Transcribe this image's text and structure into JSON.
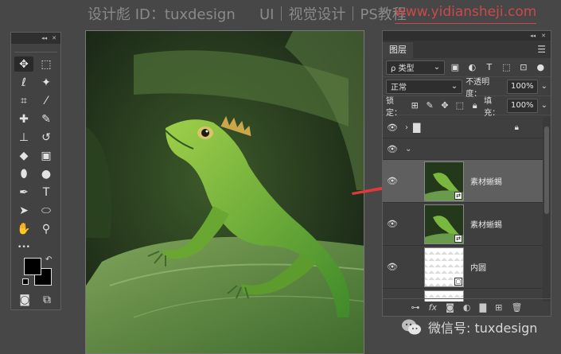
{
  "watermark": {
    "designer": "设计彪 ID：tuxdesign",
    "topic": "UI｜视觉设计｜PS教程",
    "site": "www.yidiansheji.com"
  },
  "tools_panel": {
    "header_icons": [
      "collapse-icon",
      "close-icon"
    ],
    "tools": [
      {
        "name": "move-tool-icon",
        "glyph": "✥",
        "active": true
      },
      {
        "name": "marquee-tool-icon",
        "glyph": "⬚"
      },
      {
        "name": "lasso-tool-icon",
        "glyph": "ℓ"
      },
      {
        "name": "magic-wand-tool-icon",
        "glyph": "✦"
      },
      {
        "name": "crop-tool-icon",
        "glyph": "⌗"
      },
      {
        "name": "eyedropper-tool-icon",
        "glyph": "⁄"
      },
      {
        "name": "healing-brush-tool-icon",
        "glyph": "✚"
      },
      {
        "name": "brush-tool-icon",
        "glyph": "✎"
      },
      {
        "name": "clone-stamp-tool-icon",
        "glyph": "⊥"
      },
      {
        "name": "history-brush-tool-icon",
        "glyph": "↺"
      },
      {
        "name": "eraser-tool-icon",
        "glyph": "◆"
      },
      {
        "name": "gradient-tool-icon",
        "glyph": "▣"
      },
      {
        "name": "blur-tool-icon",
        "glyph": "⬮"
      },
      {
        "name": "dodge-tool-icon",
        "glyph": "●"
      },
      {
        "name": "pen-tool-icon",
        "glyph": "✒"
      },
      {
        "name": "type-tool-icon",
        "glyph": "T"
      },
      {
        "name": "path-selection-tool-icon",
        "glyph": "➤"
      },
      {
        "name": "ellipse-tool-icon",
        "glyph": "⬭"
      },
      {
        "name": "hand-tool-icon",
        "glyph": "✋"
      },
      {
        "name": "zoom-tool-icon",
        "glyph": "⚲"
      },
      {
        "name": "more-tools-icon",
        "glyph": "•••"
      }
    ],
    "foreground_color": "#000000",
    "background_color": "#000000"
  },
  "layers_panel": {
    "tab_label": "图层",
    "filter": {
      "label": "ρ 类型"
    },
    "blend_mode": "正常",
    "opacity_label": "不透明度：",
    "opacity_value": "100%",
    "lock_label": "锁定：",
    "fill_label": "填充：",
    "fill_value": "100%",
    "layers": [
      {
        "name": "",
        "type": "group-collapsed",
        "visible": true,
        "locked": true
      },
      {
        "name": "",
        "type": "group-expanded",
        "visible": true
      },
      {
        "name": "素材蜥蜴",
        "type": "smart-object",
        "visible": true,
        "selected": true
      },
      {
        "name": "素材蜥蜴",
        "type": "smart-object",
        "visible": true
      },
      {
        "name": "内圆",
        "type": "shape",
        "visible": true
      },
      {
        "name": "",
        "type": "shape",
        "visible": false
      }
    ],
    "bottom_icons": [
      "link-layers-icon",
      "fx-icon",
      "mask-icon",
      "adjustment-layer-icon",
      "new-group-icon",
      "new-layer-icon",
      "delete-layer-icon"
    ]
  },
  "footer": {
    "wechat_label": "微信号: tuxdesign"
  },
  "colors": {
    "app_background": "#474747",
    "panel": "#3f3f3f",
    "selected_layer": "#5f5f5f",
    "arrow": "#e0393a",
    "lizard_green": "#6bb03a"
  }
}
